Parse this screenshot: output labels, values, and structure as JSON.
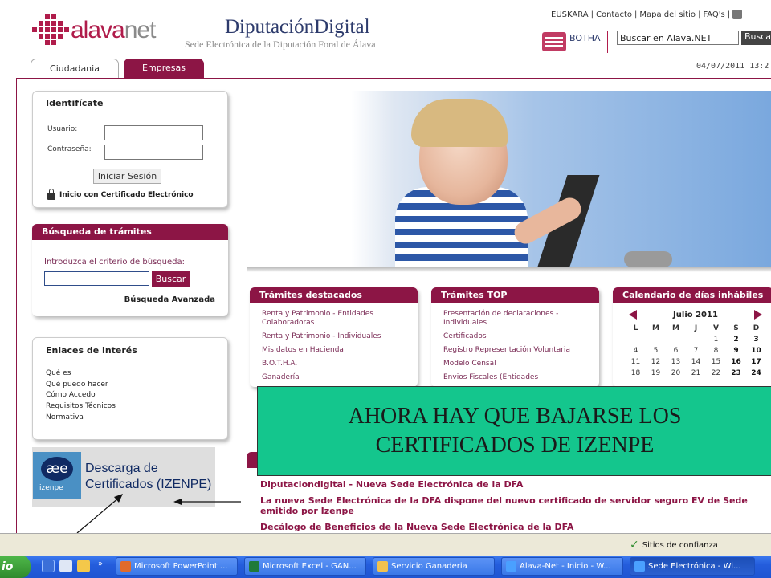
{
  "header": {
    "brand_left_1": "alava",
    "brand_left_2": "net",
    "brand_right": "DiputaciónDigital",
    "brand_right_sub": "Sede Electrónica de la Diputación Foral de Álava",
    "top_links": [
      "EUSKARA",
      "Contacto",
      "Mapa del sitio",
      "FAQ's"
    ],
    "botha_label": "BOTHA",
    "search_value": "Buscar en Alava.NET",
    "search_button": "Busca",
    "datetime": "04/07/2011 13:2"
  },
  "tabs": [
    "Ciudadania",
    "Empresas"
  ],
  "login": {
    "title": "Identifícate",
    "user_label": "Usuario:",
    "pass_label": "Contraseña:",
    "button": "Iniciar Sesión",
    "cert_link": "Inicio con Certificado Electrónico"
  },
  "search_tramites": {
    "title": "Búsqueda de trámites",
    "prompt": "Introduzca el criterio de búsqueda:",
    "button": "Buscar",
    "advanced": "Búsqueda Avanzada"
  },
  "links": {
    "title": "Enlaces de interés",
    "items": [
      "Qué es",
      "Qué puedo hacer",
      "Cómo Accedo",
      "Requisitos Técnicos",
      "Normativa"
    ]
  },
  "izenpe": {
    "logo_glyph": "æe",
    "logo_text": "izenpe",
    "line1": "Descarga de",
    "line2": "Certificados (IZENPE)"
  },
  "destacados": {
    "title": "Trámites destacados",
    "items": [
      "Renta y Patrimonio - Entidades Colaboradoras",
      "Renta y Patrimonio - Individuales",
      "Mis datos en Hacienda",
      "B.O.T.H.A.",
      "Ganadería"
    ]
  },
  "top": {
    "title": "Trámites TOP",
    "items": [
      "Presentación de declaraciones - Individuales",
      "Certificados",
      "Registro Representación Voluntaria",
      "Modelo Censal",
      "Envios Fiscales (Entidades"
    ]
  },
  "calendar": {
    "title": "Calendario de días inhábiles",
    "month": "Julio 2011",
    "days_header": [
      "L",
      "M",
      "M",
      "J",
      "V",
      "S",
      "D"
    ],
    "rows": [
      [
        "",
        "",
        "",
        "",
        "1",
        "2",
        "3"
      ],
      [
        "4",
        "5",
        "6",
        "7",
        "8",
        "9",
        "10"
      ],
      [
        "11",
        "12",
        "13",
        "14",
        "15",
        "16",
        "17"
      ],
      [
        "18",
        "19",
        "20",
        "21",
        "22",
        "23",
        "24"
      ]
    ]
  },
  "news": [
    "Diputaciondigital - Nueva Sede Electrónica de la DFA",
    "La nueva Sede Electrónica de la DFA dispone del nuevo certificado de servidor seguro EV de Sede emitido por Izenpe",
    "Decálogo de Beneficios de la Nueva Sede Electrónica de la DFA"
  ],
  "overlay_text": "AHORA HAY QUE BAJARSE LOS CERTIFICADOS DE IZENPE",
  "status": {
    "trusted": "Sitios de confianza"
  },
  "taskbar": {
    "start": "io",
    "tasks": [
      "Microsoft PowerPoint ...",
      "Microsoft Excel - GAN...",
      "Servicio Ganaderia",
      "Alava-Net - Inicio - W...",
      "Sede Electrónica - Wi..."
    ]
  },
  "colors": {
    "brand": "#8c1545",
    "overlay": "#14c68d",
    "taskbar": "#245ddc"
  }
}
